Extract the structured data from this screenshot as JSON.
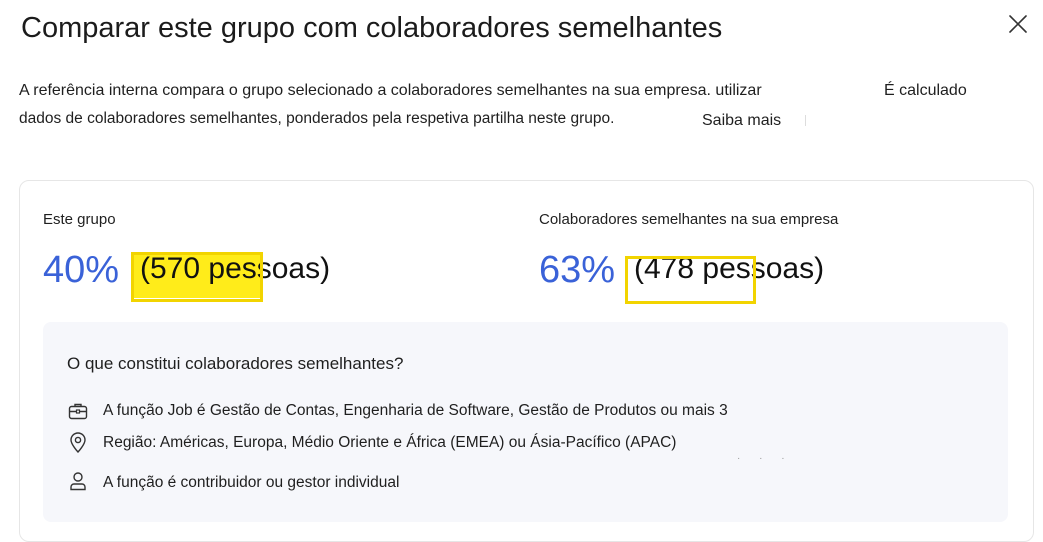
{
  "header": {
    "title": "Comparar este grupo com colaboradores semelhantes"
  },
  "description": {
    "line1": "A referência interna compara o grupo selecionado a colaboradores semelhantes na sua empresa. utilizar",
    "line1_tail": "É calculado",
    "line2": "dados de colaboradores semelhantes, ponderados pela respetiva partilha neste grupo.",
    "learn_more": "Saiba mais"
  },
  "comparison": {
    "group": {
      "label": "Este grupo",
      "percent": "40%",
      "people": "(570 pessoas)"
    },
    "peers": {
      "label": "Colaboradores semelhantes na sua empresa",
      "percent": "63%",
      "people": "(478 pessoas)"
    }
  },
  "peer_definition": {
    "title": "O que constitui colaboradores semelhantes?",
    "items": [
      {
        "icon": "briefcase-icon",
        "text": "A função Job é Gestão de Contas, Engenharia de Software, Gestão de Produtos ou mais 3"
      },
      {
        "icon": "location-pin-icon",
        "text": "Região: Américas, Europa, Médio Oriente e África (EMEA) ou Ásia-Pacífico (APAC)"
      },
      {
        "icon": "person-icon",
        "text": "A função é contribuidor ou gestor individual"
      }
    ]
  },
  "colors": {
    "accent_blue": "#3a62d8",
    "highlight_yellow": "#ffec1a",
    "highlight_border": "#f2d400",
    "panel_bg": "#f6f7fb"
  }
}
